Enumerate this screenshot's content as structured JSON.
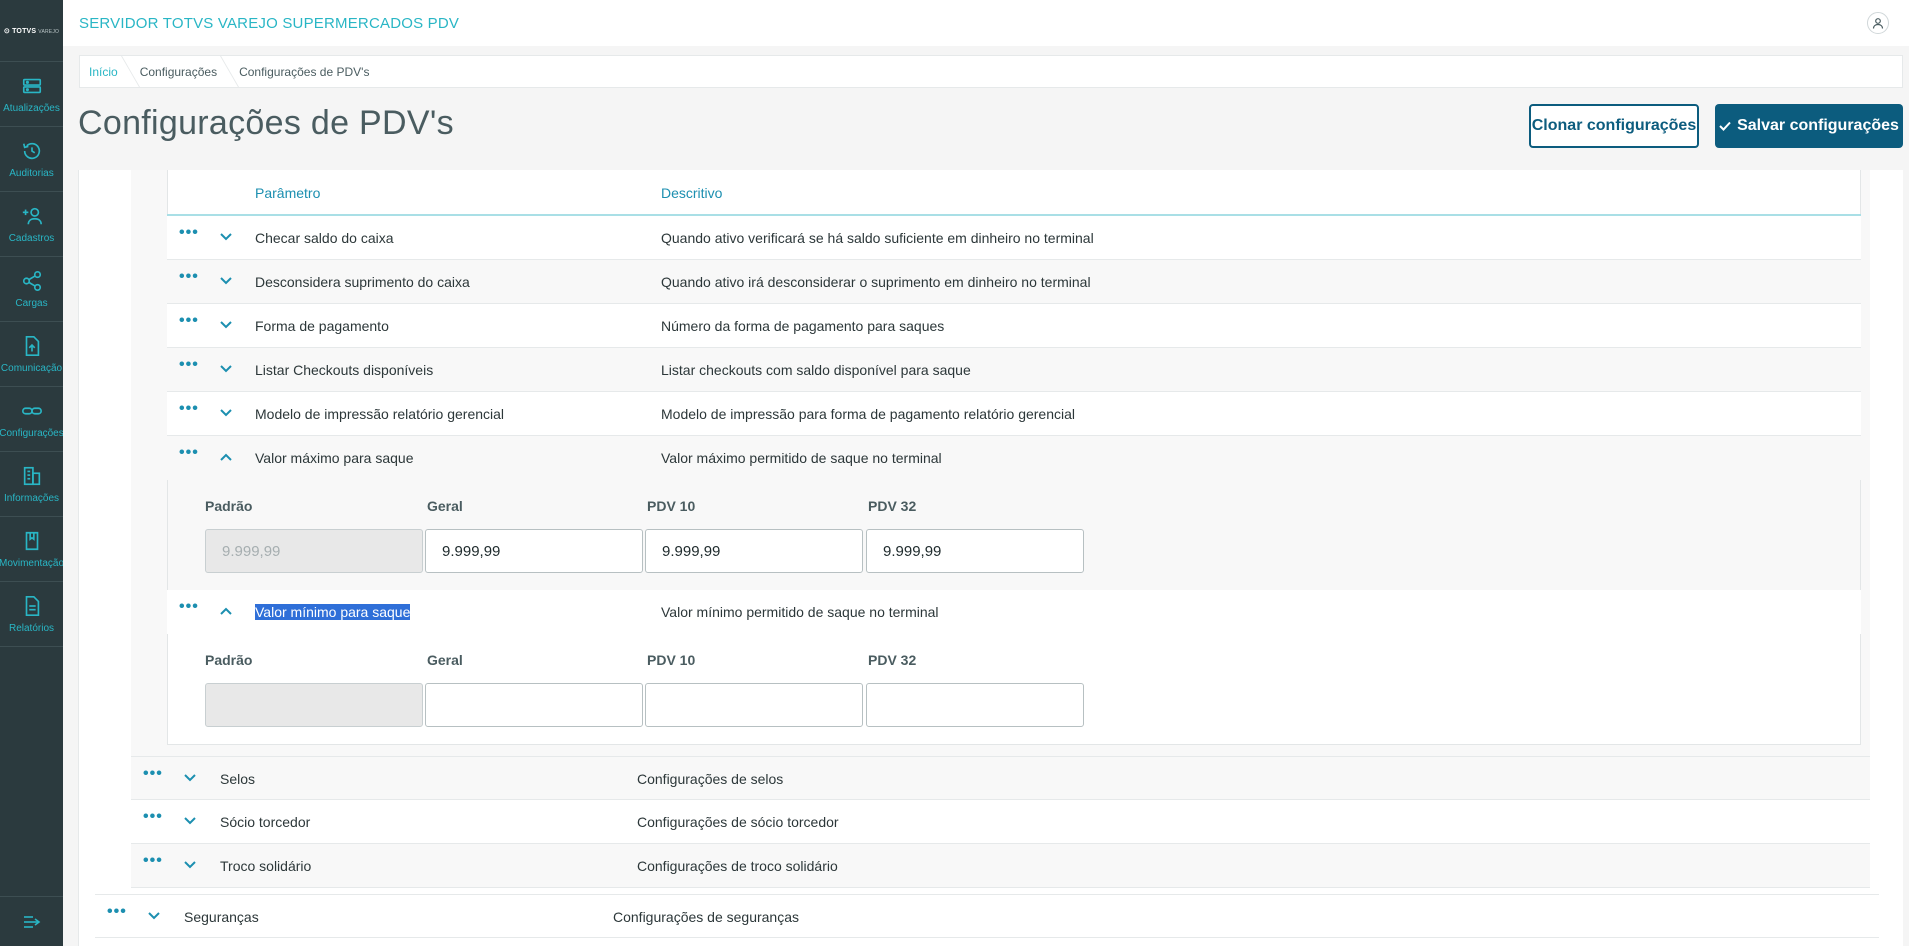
{
  "sidebar": {
    "logo": "TOTVS",
    "logo_sub": "VAREJO",
    "items": [
      {
        "label": "Atualizações",
        "icon": "server-icon"
      },
      {
        "label": "Auditorias",
        "icon": "history-icon"
      },
      {
        "label": "Cadastros",
        "icon": "add-user-icon"
      },
      {
        "label": "Cargas",
        "icon": "share-icon"
      },
      {
        "label": "Comunicação",
        "icon": "file-upload-icon"
      },
      {
        "label": "Configurações",
        "icon": "link-icon"
      },
      {
        "label": "Informações",
        "icon": "building-icon"
      },
      {
        "label": "Movimentação",
        "icon": "book-icon"
      },
      {
        "label": "Relatórios",
        "icon": "document-icon"
      }
    ],
    "toggle_icon": "expand-menu-icon"
  },
  "header": {
    "app_title": "SERVIDOR TOTVS VAREJO SUPERMERCADOS PDV",
    "user_icon": "user-icon"
  },
  "breadcrumb": [
    "Início",
    "Configurações",
    "Configurações de PDV's"
  ],
  "page": {
    "title": "Configurações de PDV's",
    "clone_label": "Clonar configurações",
    "save_label": "Salvar configurações"
  },
  "table": {
    "col_param": "Parâmetro",
    "col_desc": "Descritivo",
    "rows": [
      {
        "name": "Checar saldo do caixa",
        "desc": "Quando ativo verificará se há saldo suficiente em dinheiro no terminal",
        "expanded": false
      },
      {
        "name": "Desconsidera suprimento do caixa",
        "desc": "Quando ativo irá desconsiderar o suprimento em dinheiro no terminal",
        "expanded": false
      },
      {
        "name": "Forma de pagamento",
        "desc": "Número da forma de pagamento para saques",
        "expanded": false
      },
      {
        "name": "Listar Checkouts disponíveis",
        "desc": "Listar checkouts com saldo disponível para saque",
        "expanded": false
      },
      {
        "name": "Modelo de impressão relatório gerencial",
        "desc": "Modelo de impressão para forma de pagamento relatório gerencial",
        "expanded": false
      },
      {
        "name": "Valor máximo para saque",
        "desc": "Valor máximo permitido de saque no terminal",
        "expanded": true
      },
      {
        "name": "Valor mínimo para saque",
        "desc": "Valor mínimo permitido de saque no terminal",
        "expanded": true
      }
    ],
    "max_detail": {
      "labels": [
        "Padrão",
        "Geral",
        "PDV 10",
        "PDV 32"
      ],
      "values": [
        "9.999,99",
        "9.999,99",
        "9.999,99",
        "9.999,99"
      ]
    },
    "min_detail": {
      "labels": [
        "Padrão",
        "Geral",
        "PDV 10",
        "PDV 32"
      ],
      "values": [
        "",
        "",
        "",
        ""
      ]
    }
  },
  "groups": [
    {
      "name": "Selos",
      "desc": "Configurações de selos"
    },
    {
      "name": "Sócio torcedor",
      "desc": "Configurações de sócio torcedor"
    },
    {
      "name": "Troco solidário",
      "desc": "Configurações de troco solidário"
    }
  ],
  "top_group": {
    "name": "Seguranças",
    "desc": "Configurações de seguranças"
  },
  "colors": {
    "sidebar_bg": "#2b3a3e",
    "accent": "#29b6c5",
    "primary": "#0c5c7e",
    "link": "#1c8fb0",
    "selection": "#2f6fd8"
  }
}
